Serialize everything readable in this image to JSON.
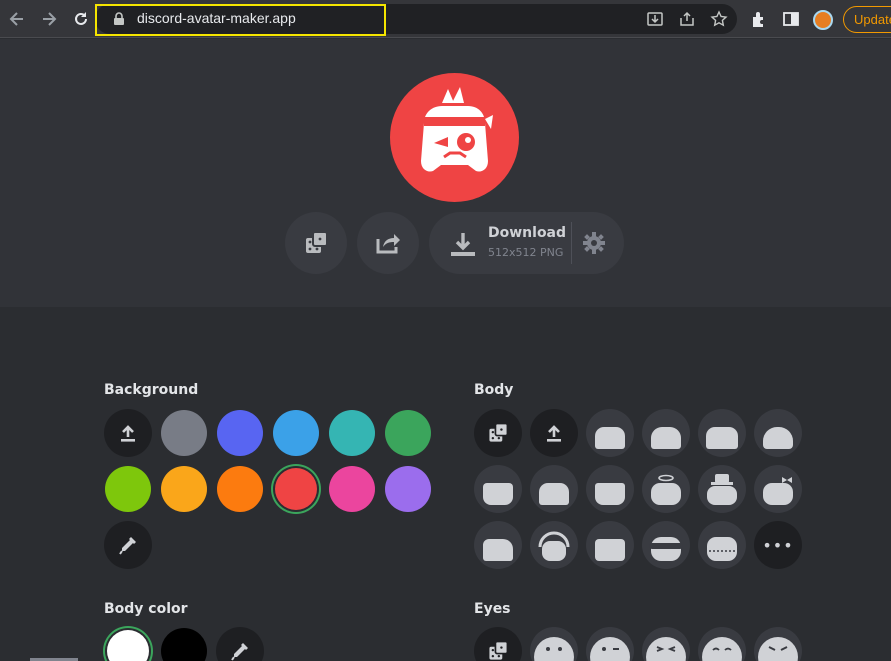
{
  "browser": {
    "url": "discord-avatar-maker.app",
    "update_label": "Update",
    "icons": [
      "back-icon",
      "forward-icon",
      "reload-icon",
      "lock-icon",
      "install-icon",
      "share-icon",
      "star-icon",
      "extensions-icon",
      "sidebar-icon",
      "profile-icon"
    ]
  },
  "hero": {
    "avatar_color": "#ef4444",
    "download_label": "Download",
    "download_sub": "512x512 PNG",
    "buttons": [
      "randomize-dice",
      "share",
      "download",
      "settings"
    ]
  },
  "panel": {
    "background": {
      "title": "Background",
      "colors": [
        "#787c86",
        "#5865f2",
        "#3ba1e8",
        "#35b5b3",
        "#3ba55c",
        "#7ec70c",
        "#faa61a",
        "#fc7b0f",
        "#ef4444",
        "#eb459e",
        "#9b6ded"
      ],
      "selected": "#ef4444"
    },
    "body": {
      "title": "Body",
      "more_label": "•••"
    },
    "body_color": {
      "title": "Body color",
      "colors": [
        "#ffffff",
        "#000000"
      ],
      "selected": "#ffffff"
    },
    "eyes": {
      "title": "Eyes"
    }
  }
}
